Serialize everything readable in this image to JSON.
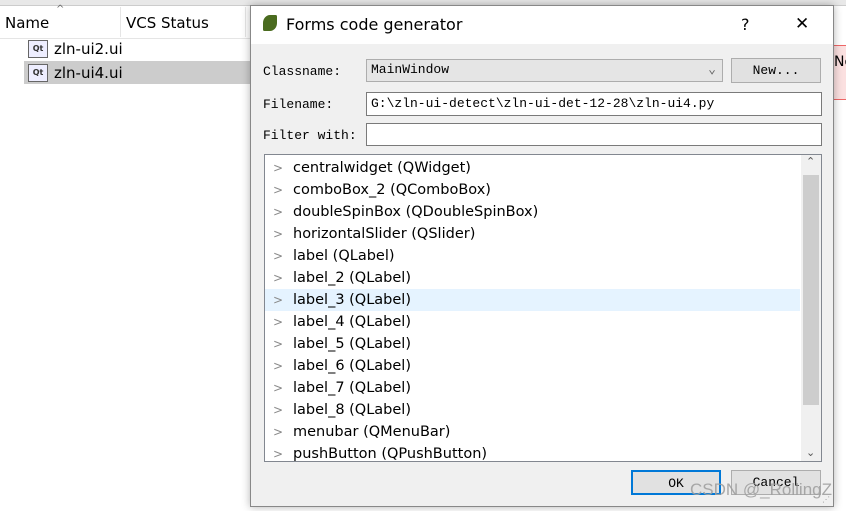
{
  "file_panel": {
    "columns": [
      "Name",
      "VCS Status"
    ],
    "files": [
      {
        "name": "zln-ui2.ui",
        "selected": false
      },
      {
        "name": "zln-ui4.ui",
        "selected": true
      }
    ],
    "icon": "qt-designer-file-icon"
  },
  "background_partial_text": "No",
  "dialog": {
    "title": "Forms code generator",
    "help_label": "?",
    "close_label": "✕",
    "classname_label": "Classname:",
    "classname_value": "MainWindow",
    "new_button": "New...",
    "filename_label": "Filename:",
    "filename_value": "G:\\zln-ui-detect\\zln-ui-det-12-28\\zln-ui4.py",
    "filter_label": "Filter with:",
    "filter_value": "",
    "tree_items": [
      "centralwidget (QWidget)",
      "comboBox_2 (QComboBox)",
      "doubleSpinBox (QDoubleSpinBox)",
      "horizontalSlider (QSlider)",
      "label (QLabel)",
      "label_2 (QLabel)",
      "label_3 (QLabel)",
      "label_4 (QLabel)",
      "label_5 (QLabel)",
      "label_6 (QLabel)",
      "label_7 (QLabel)",
      "label_8 (QLabel)",
      "menubar (QMenuBar)",
      "pushButton (QPushButton)"
    ],
    "highlighted_item": "label_3 (QLabel)",
    "ok_button": "OK",
    "cancel_button": "Cancel"
  },
  "watermark": "CSDN @_RollingZ",
  "colors": {
    "focus": "#0078d7",
    "selected_file": "#cccccc",
    "hover_row": "#e5f3ff"
  }
}
